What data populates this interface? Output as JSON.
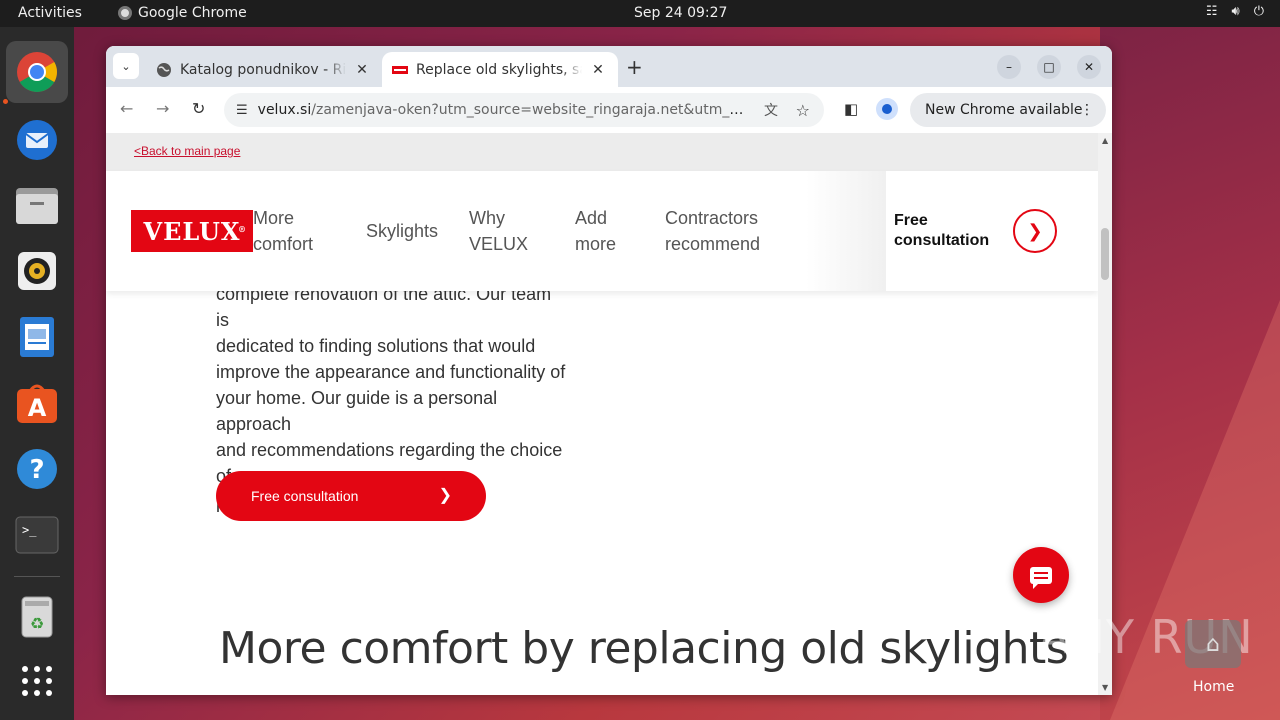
{
  "topbar": {
    "activities": "Activities",
    "app_name": "Google Chrome",
    "datetime": "Sep 24  09:27"
  },
  "browser": {
    "tabs": [
      {
        "title": "Katalog ponudnikov - Ringaraja",
        "active": false
      },
      {
        "title": "Replace old skylights, save energy",
        "active": true
      }
    ],
    "url_host": "velux.si",
    "url_rest": "/zamenjava-oken?utm_source=website_ringaraja.net&utm_medium...",
    "update_chip": "New Chrome available"
  },
  "page": {
    "back_link": "<Back to main page",
    "logo": "VELUX",
    "nav": [
      {
        "line1": "More",
        "line2": "comfort"
      },
      {
        "line1": "Skylights",
        "line2": ""
      },
      {
        "line1": "Why",
        "line2": "VELUX"
      },
      {
        "line1": "Add",
        "line2": "more"
      },
      {
        "line1": "Contractors",
        "line2": "recommend"
      }
    ],
    "nav_cta_line1": "Free",
    "nav_cta_line2": "consultation",
    "body_lines": [
      "complete renovation of the attic. Our team is",
      "dedicated to finding solutions that would",
      "improve the appearance and functionality of",
      "your home. Our guide is a personal approach",
      "and recommendations regarding the choice of",
      "products adapted to your wishes."
    ],
    "cta_button": "Free consultation",
    "section_heading": "More comfort by replacing old skylights"
  },
  "desktop": {
    "home_label": "Home",
    "watermark": "ANY RUN"
  },
  "colors": {
    "brand_red": "#e30613",
    "topbar": "#1d1d1d",
    "dock": "#2a2a2a"
  }
}
